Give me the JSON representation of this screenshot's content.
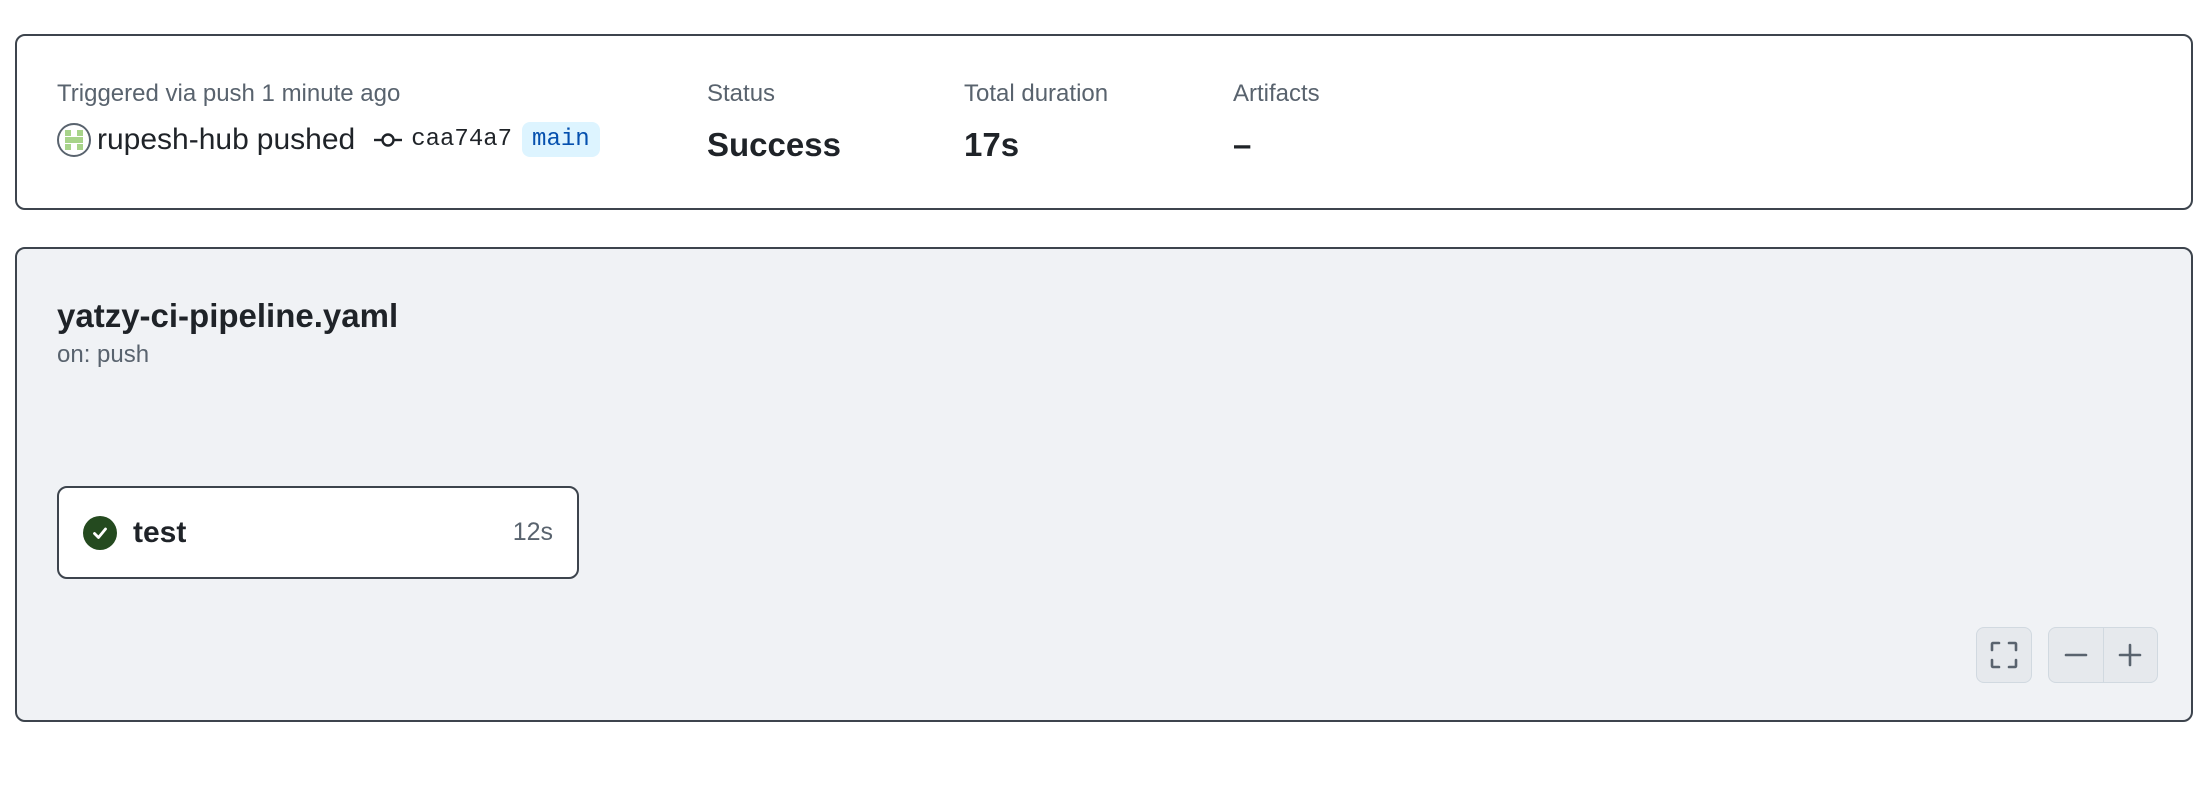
{
  "summary": {
    "trigger_label": "Triggered via push 1 minute ago",
    "actor": "rupesh-hub",
    "action": "pushed",
    "commit_sha": "caa74a7",
    "branch": "main",
    "status_label": "Status",
    "status_value": "Success",
    "duration_label": "Total duration",
    "duration_value": "17s",
    "artifacts_label": "Artifacts",
    "artifacts_value": "–"
  },
  "workflow": {
    "file_name": "yatzy-ci-pipeline.yaml",
    "trigger": "on: push"
  },
  "jobs": [
    {
      "name": "test",
      "duration": "12s",
      "status": "success",
      "icon": "check-circle-icon"
    }
  ],
  "controls": {
    "fullscreen_icon": "fullscreen-icon",
    "zoom_out_icon": "minus-icon",
    "zoom_in_icon": "plus-icon"
  },
  "colors": {
    "success": "#244a1f",
    "branch_bg": "#ddf4ff",
    "branch_fg": "#0550ae",
    "graph_bg": "#f0f2f5"
  }
}
